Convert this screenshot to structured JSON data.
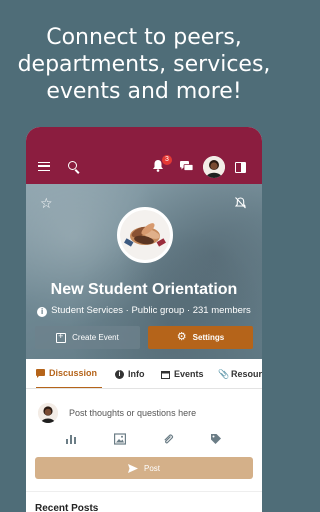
{
  "headline": {
    "line1": "Connect to peers,",
    "line2": "departments, services,",
    "line3": "events and more!"
  },
  "topbar": {
    "notification_count": "3",
    "icons": [
      "menu-icon",
      "search-icon",
      "bell-icon",
      "chat-icon",
      "avatar",
      "panel-icon"
    ]
  },
  "group": {
    "title": "New Student Orientation",
    "department": "Student Services",
    "visibility": "Public group",
    "members": "231 members",
    "separator": "·"
  },
  "actions": {
    "create_event": "Create Event",
    "settings": "Settings"
  },
  "tabs": [
    {
      "label": "Discussion",
      "active": true
    },
    {
      "label": "Info",
      "active": false
    },
    {
      "label": "Events",
      "active": false
    },
    {
      "label": "Resources",
      "active": false
    }
  ],
  "composer": {
    "placeholder": "Post thoughts or questions here",
    "post_label": "Post",
    "tools": [
      "poll-icon",
      "image-icon",
      "attachment-icon",
      "tag-icon"
    ]
  },
  "recent_posts": {
    "heading": "Recent Posts"
  },
  "colors": {
    "background": "#4f6d78",
    "topbar": "#8b1d3f",
    "accent": "#b5641a",
    "post_button": "#d4b089"
  }
}
